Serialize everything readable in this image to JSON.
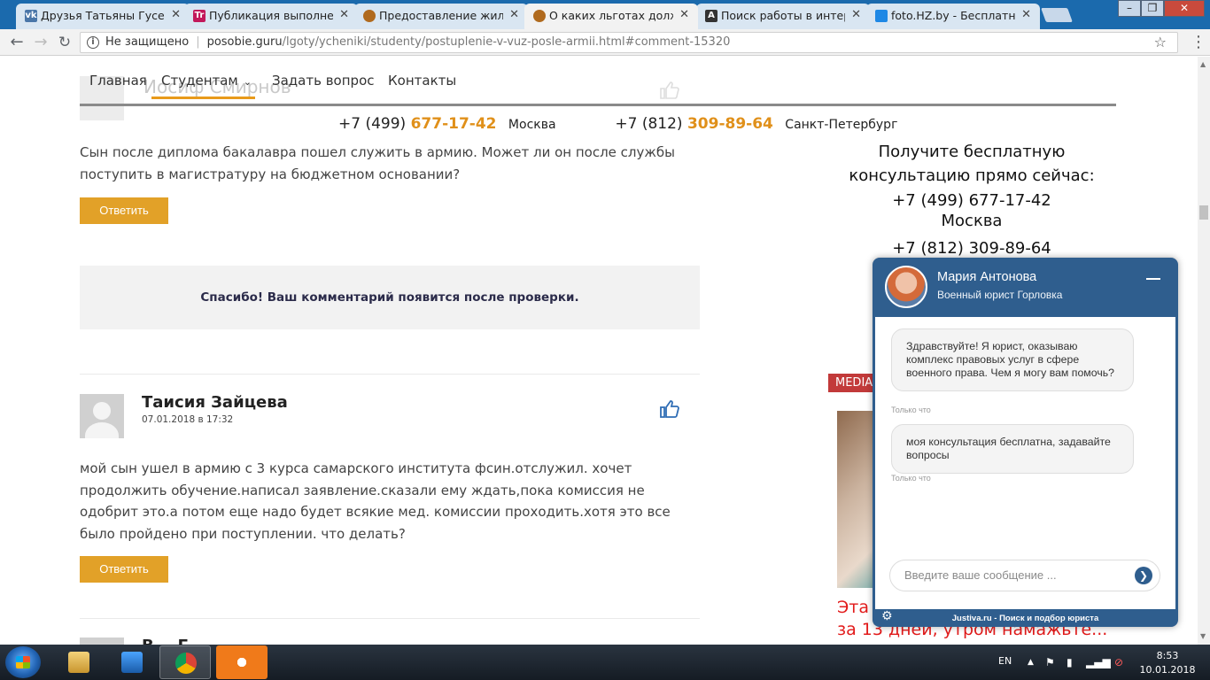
{
  "browser": {
    "tabs": [
      {
        "title": "Друзья Татьяны Гусевой",
        "favicon": "vk-icon",
        "color": "#4a76a8",
        "glyph": "vk",
        "active": false
      },
      {
        "title": "Публикация выполнена",
        "favicon": "text-icon",
        "color": "#c2185b",
        "glyph": "Tr",
        "active": false
      },
      {
        "title": "Предоставление жилья",
        "favicon": "emblem-icon",
        "color": "#b06a1e",
        "glyph": "",
        "active": false
      },
      {
        "title": "О каких льготах должны",
        "favicon": "emblem-icon",
        "color": "#b06a1e",
        "glyph": "",
        "active": true
      },
      {
        "title": "Поиск работы в интерне",
        "favicon": "a-icon",
        "color": "#333333",
        "glyph": "A",
        "active": false
      },
      {
        "title": "foto.HZ.by - Бесплатный",
        "favicon": "camera-icon",
        "color": "#1e88e5",
        "glyph": "",
        "active": false
      }
    ],
    "address": {
      "security": "Не защищено",
      "domain": "posobie.guru",
      "path": "/lgoty/ycheniki/studenty/postuplenie-v-vuz-posle-armii.html#comment-15320"
    }
  },
  "site": {
    "nav": [
      {
        "label": "Главная",
        "active": false
      },
      {
        "label": "Студентам",
        "active": true,
        "dropdown": true
      },
      {
        "label": "Задать вопрос",
        "active": false
      },
      {
        "label": "Контакты",
        "active": false
      }
    ],
    "phones": [
      {
        "prefix": "+7 (499)",
        "number": "677-17-42",
        "city": "Москва"
      },
      {
        "prefix": "+7 (812)",
        "number": "309-89-64",
        "city": "Санкт-Петербург"
      }
    ],
    "ghost_author": "Иосиф Смирнов",
    "comment1_text": "Сын после диплома бакалавра пошел служить в армию. Может ли он после службы поступить в магистратуру на бюджетном основании?",
    "reply_label": "Ответить",
    "thanks_message": "Спасибо! Ваш комментарий появится после проверки.",
    "comment2": {
      "author": "Таисия Зайцева",
      "date": "07.01.2018 в 17:32",
      "text": "мой сын ушел в армию с 3 курса самарского института фсин.отслужил. хочет продолжить обучение.написал заявление.сказали ему ждать,пока комиссия не одобрит это.а потом еще надо будет всякие мед. комиссии проходить.хотя это все было пройдено при поступлении. что делать?"
    },
    "comment3_author_partial": "В... Г..."
  },
  "sidebar": {
    "consult_title": "Получите бесплатную консультацию прямо сейчас:",
    "phone1": "+7 (499) 677-17-42",
    "city1": "Москва",
    "phone2": "+7 (812) 309-89-64",
    "media_tag": "MEDIA",
    "promo_line1": "Эта",
    "promo_line2": "за 13 дней, утром намажьте..."
  },
  "chat": {
    "agent_name": "Мария Антонова",
    "agent_role": "Военный юрист Горловка",
    "messages": [
      {
        "text": "Здравствуйте! Я юрист, оказываю комплекс правовых услуг в сфере военного права. Чем я могу вам помочь?",
        "time": "Только что"
      },
      {
        "text": "моя консультация бесплатна, задавайте вопросы",
        "time": "Только что"
      }
    ],
    "input_placeholder": "Введите ваше сообщение ...",
    "footer": "Justiva.ru - Поиск и подбор юриста"
  },
  "taskbar": {
    "apps": [
      "explorer-icon",
      "media-player-icon",
      "chrome-icon",
      "avast-icon"
    ],
    "language": "EN",
    "time": "8:53",
    "date": "10.01.2018"
  }
}
